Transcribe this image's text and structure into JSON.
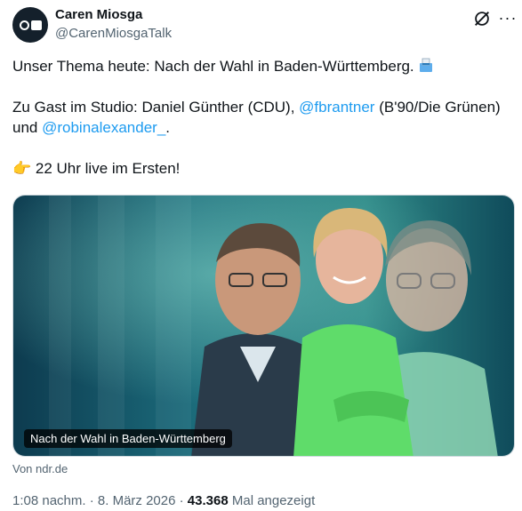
{
  "author": {
    "name": "Caren Miosga",
    "handle": "@CarenMiosgaTalk"
  },
  "tweet": {
    "line1": "Unser Thema heute: Nach der Wahl in Baden-Württemberg. ",
    "line2_prefix": "Zu Gast im Studio: Daniel Günther (CDU), ",
    "mention1": "@fbrantner",
    "line2_suffix": " (B'90/Die Grünen)",
    "line3_prefix": "und ",
    "mention2": "@robinalexander_",
    "line3_suffix": ".",
    "line4": " 22 Uhr live im Ersten!",
    "emoji_ballot": "ballot-box-emoji",
    "emoji_point": "👉"
  },
  "card": {
    "label": "Nach der Wahl in Baden-Württemberg",
    "source": "Von ndr.de"
  },
  "meta": {
    "time": "1:08 nachm.",
    "date": "8. März 2026",
    "views": "43.368",
    "views_label": " Mal angezeigt",
    "separator": " · "
  },
  "icons": [
    "grok-icon",
    "more-icon"
  ]
}
